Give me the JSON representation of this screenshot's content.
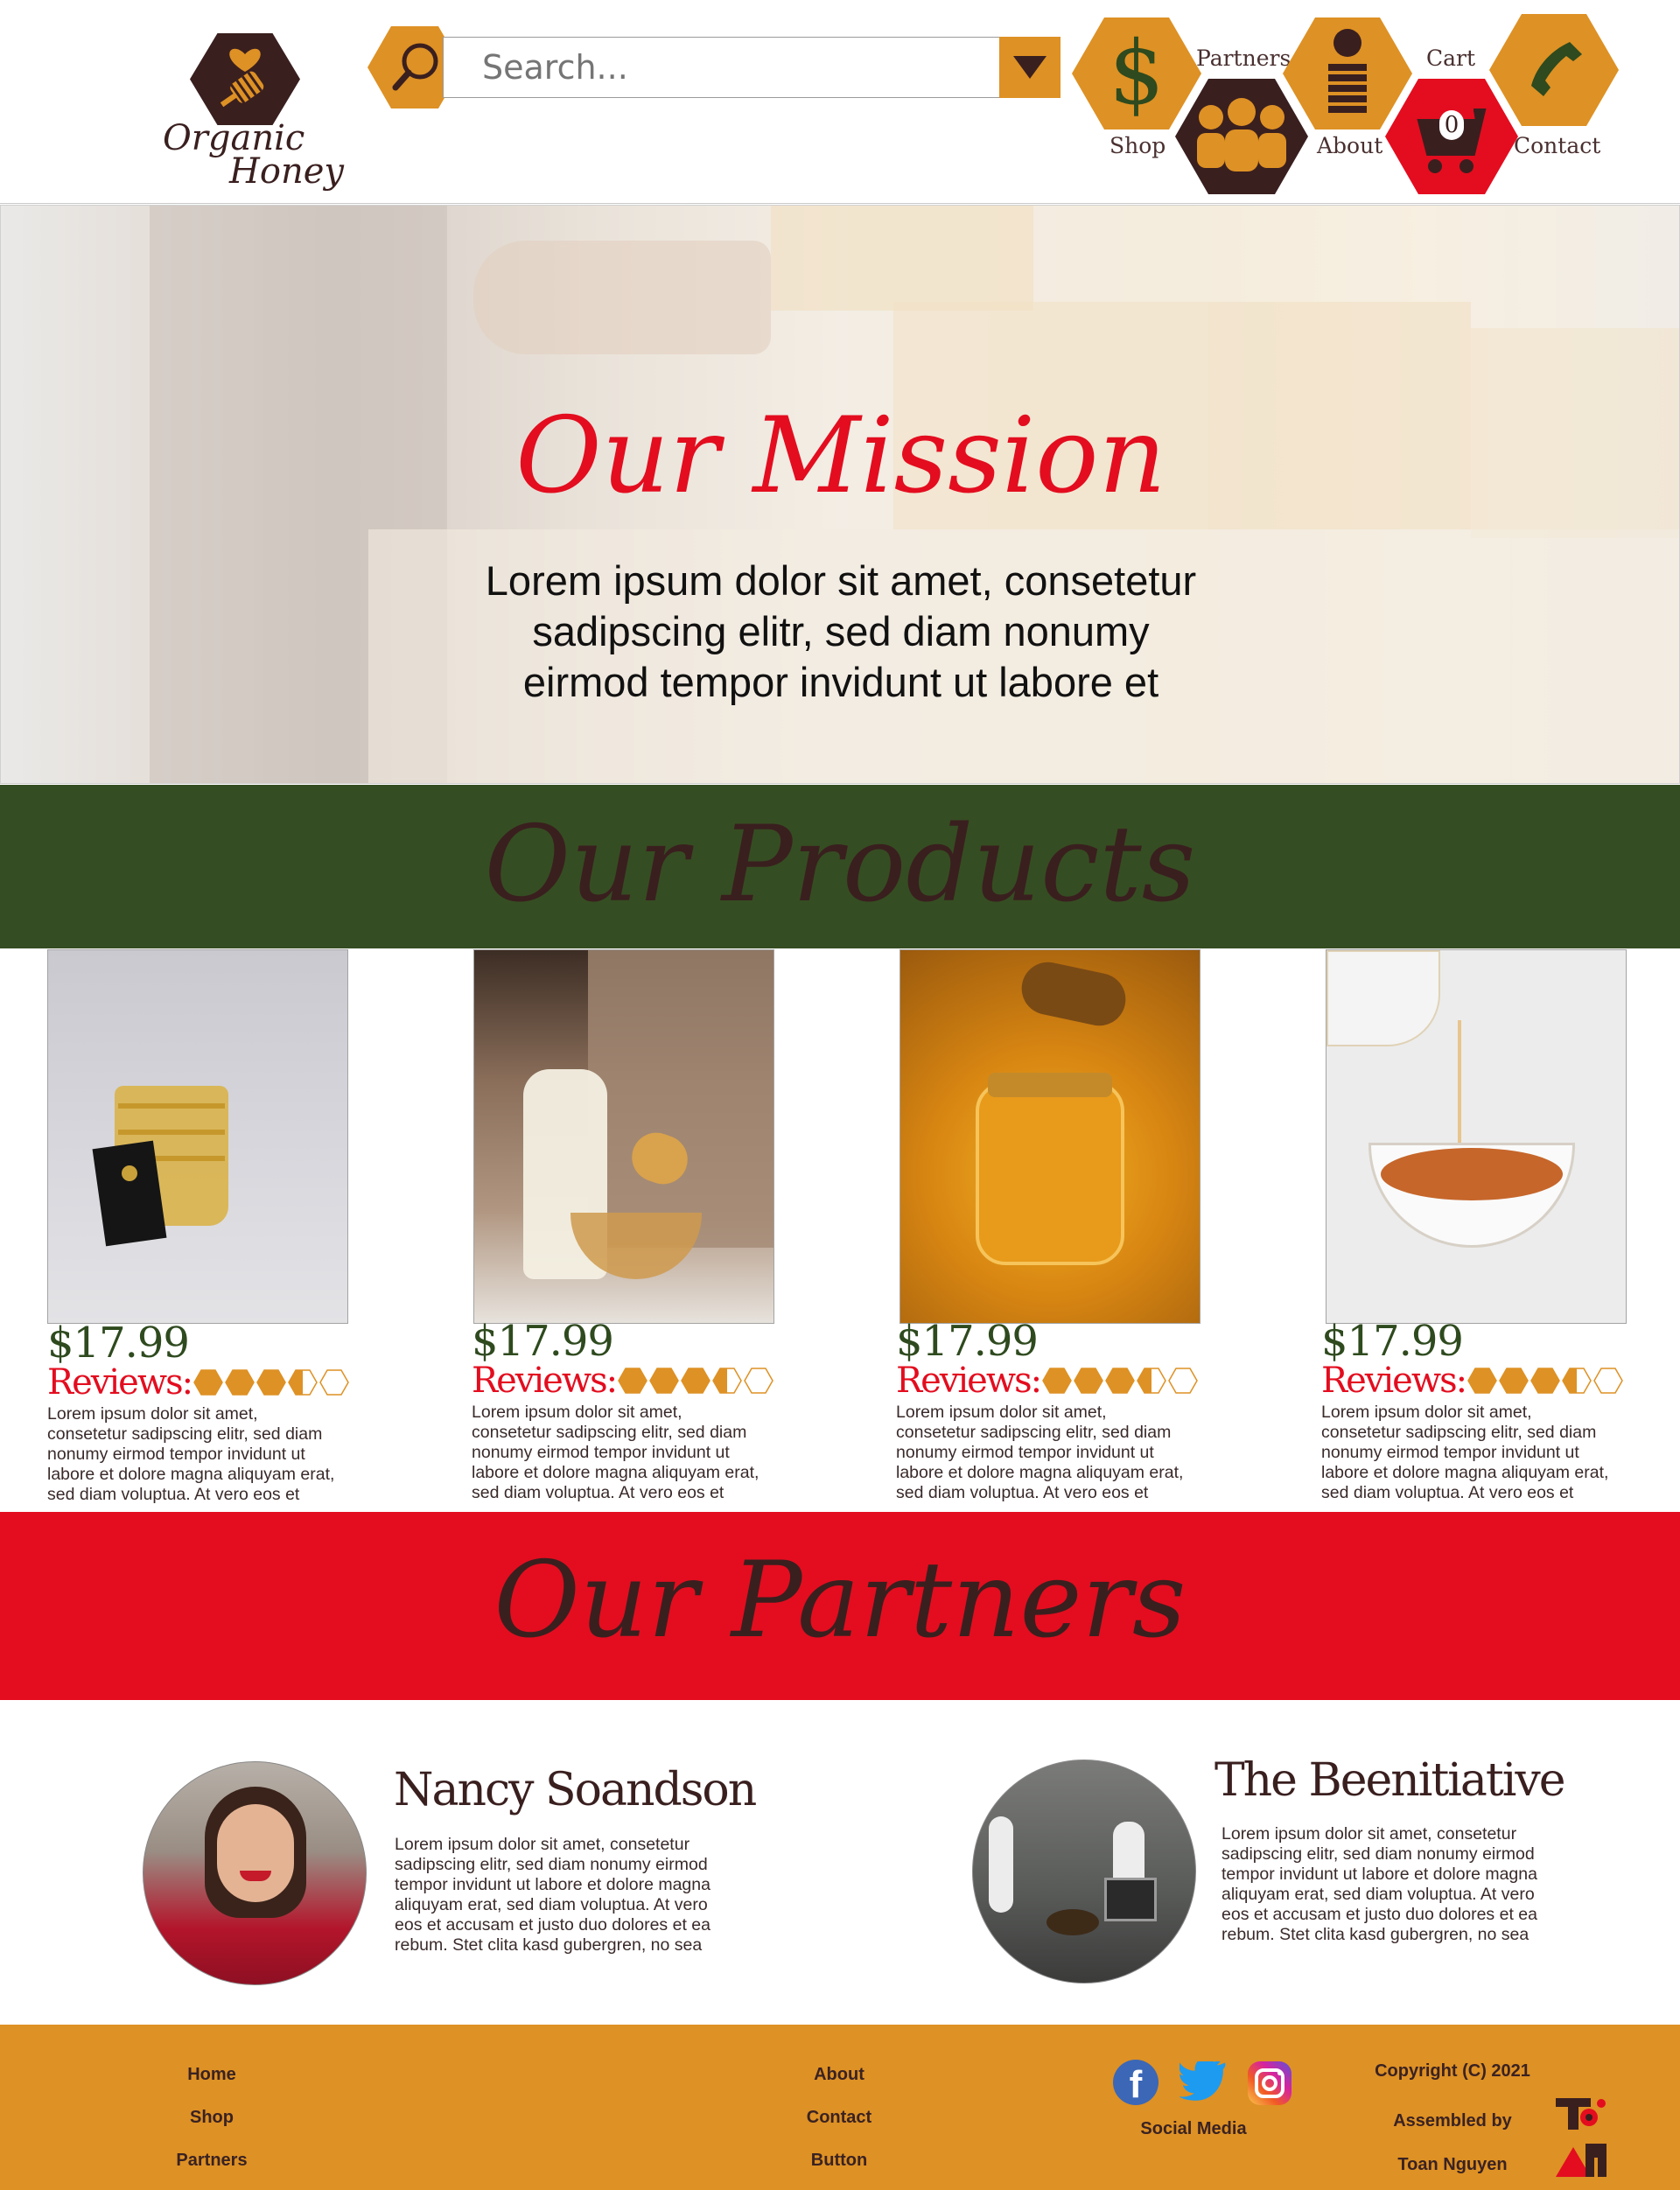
{
  "brand": {
    "line1": "Organic",
    "line2": "Honey"
  },
  "search": {
    "placeholder": "Search..."
  },
  "nav": {
    "shop": "Shop",
    "partners": "Partners",
    "about": "About",
    "cart": "Cart",
    "cart_count": "0",
    "contact": "Contact"
  },
  "hero": {
    "title": "Our Mission",
    "body_lines": [
      "Lorem ipsum dolor sit amet, consetetur",
      "sadipscing elitr, sed diam nonumy",
      "eirmod tempor invidunt ut labore et"
    ]
  },
  "products": {
    "title": "Our Products",
    "items": [
      {
        "price": "$17.99",
        "reviews_label": "Reviews:",
        "rating": 3.5,
        "rating_max": 5,
        "desc": [
          "Lorem ipsum dolor sit amet,",
          "consetetur sadipscing elitr, sed diam",
          "nonumy eirmod tempor invidunt ut",
          "labore et dolore magna aliquyam erat,",
          "sed diam voluptua. At vero eos et"
        ]
      },
      {
        "price": "$17.99",
        "reviews_label": "Reviews:",
        "rating": 3.5,
        "rating_max": 5,
        "desc": [
          "Lorem ipsum dolor sit amet,",
          "consetetur sadipscing elitr, sed diam",
          "nonumy eirmod tempor invidunt ut",
          "labore et dolore magna aliquyam erat,",
          "sed diam voluptua. At vero eos et"
        ]
      },
      {
        "price": "$17.99",
        "reviews_label": "Reviews:",
        "rating": 3.5,
        "rating_max": 5,
        "desc": [
          "Lorem ipsum dolor sit amet,",
          "consetetur sadipscing elitr, sed diam",
          "nonumy eirmod tempor invidunt ut",
          "labore et dolore magna aliquyam erat,",
          "sed diam voluptua. At vero eos et"
        ]
      },
      {
        "price": "$17.99",
        "reviews_label": "Reviews:",
        "rating": 3.5,
        "rating_max": 5,
        "desc": [
          "Lorem ipsum dolor sit amet,",
          "consetetur sadipscing elitr, sed diam",
          "nonumy eirmod tempor invidunt ut",
          "labore et dolore magna aliquyam erat,",
          "sed diam voluptua. At vero eos et"
        ]
      }
    ]
  },
  "partners": {
    "title": "Our Partners",
    "items": [
      {
        "name": "Nancy Soandson",
        "desc": [
          "Lorem ipsum dolor sit amet, consetetur",
          "sadipscing elitr, sed diam nonumy eirmod",
          "tempor invidunt ut labore et dolore magna",
          "aliquyam erat, sed diam voluptua. At vero",
          "eos et accusam et justo duo dolores et ea",
          "rebum. Stet clita kasd gubergren, no sea"
        ]
      },
      {
        "name": "The Beenitiative",
        "desc": [
          "Lorem ipsum dolor sit amet, consetetur",
          "sadipscing elitr, sed diam nonumy eirmod",
          "tempor invidunt ut labore et dolore magna",
          "aliquyam erat, sed diam voluptua. At vero",
          "eos et accusam et justo duo dolores et ea",
          "rebum. Stet clita kasd gubergren, no sea"
        ]
      }
    ]
  },
  "footer": {
    "col1": [
      "Home",
      "Shop",
      "Partners"
    ],
    "col2": [
      "About",
      "Contact",
      "Button"
    ],
    "social_label": "Social Media",
    "copyright": "Copyright (C) 2021",
    "assembled_by": "Assembled by",
    "author": "Toan Nguyen"
  },
  "colors": {
    "honey": "#de9124",
    "brown": "#3a1f1f",
    "green": "#354d22",
    "red": "#e30d1f"
  }
}
